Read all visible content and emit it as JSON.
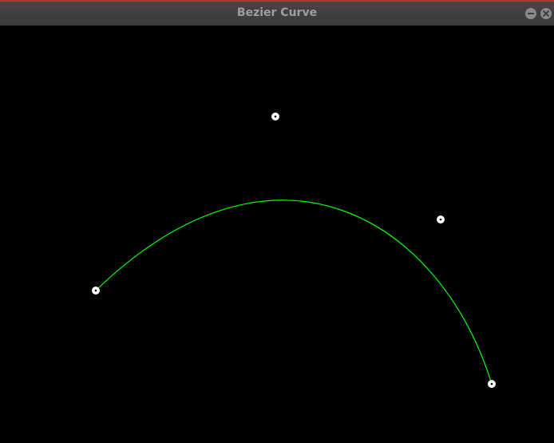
{
  "window": {
    "title": "Bezier Curve",
    "titlebar_accent": "#b8332e",
    "buttons": [
      {
        "name": "minimize-icon"
      },
      {
        "name": "close-icon"
      }
    ]
  },
  "canvas": {
    "background": "#000000",
    "curve_color": "#00ff00",
    "point_color": "#ffffff"
  }
}
